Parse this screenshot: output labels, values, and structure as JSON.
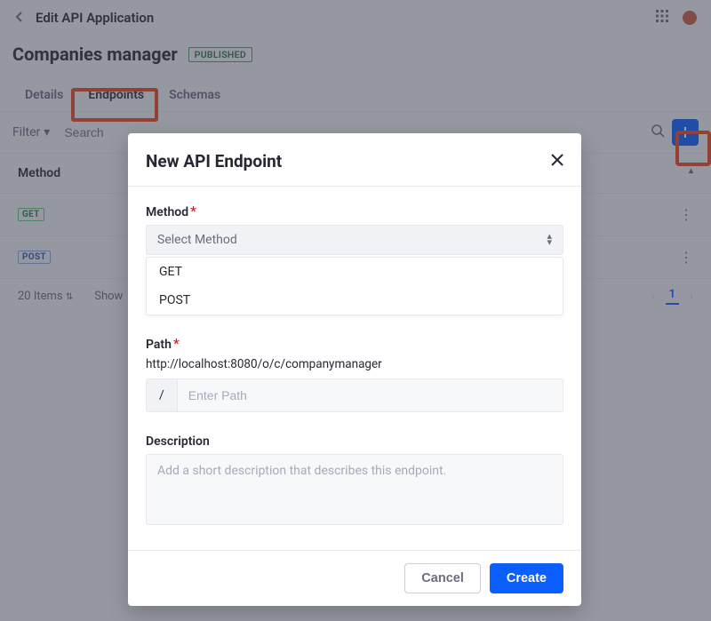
{
  "header": {
    "breadcrumb": "Edit API Application",
    "title": "Companies manager",
    "status": "PUBLISHED"
  },
  "tabs": {
    "items": [
      "Details",
      "Endpoints",
      "Schemas"
    ],
    "active_index": 1
  },
  "filterbar": {
    "filter_label": "Filter",
    "search_placeholder": "Search"
  },
  "table": {
    "header_method": "Method",
    "rows": [
      {
        "method": "GET"
      },
      {
        "method": "POST"
      }
    ]
  },
  "footer": {
    "count_label": "20 Items",
    "showing_label": "Show",
    "page": "1"
  },
  "modal": {
    "title": "New API Endpoint",
    "method": {
      "label": "Method",
      "placeholder": "Select Method",
      "options": [
        "GET",
        "POST"
      ]
    },
    "path": {
      "label": "Path",
      "base": "http://localhost:8080/o/c/companymanager",
      "prefix": "/",
      "placeholder": "Enter Path"
    },
    "description": {
      "label": "Description",
      "placeholder": "Add a short description that describes this endpoint."
    },
    "buttons": {
      "cancel": "Cancel",
      "create": "Create"
    }
  }
}
